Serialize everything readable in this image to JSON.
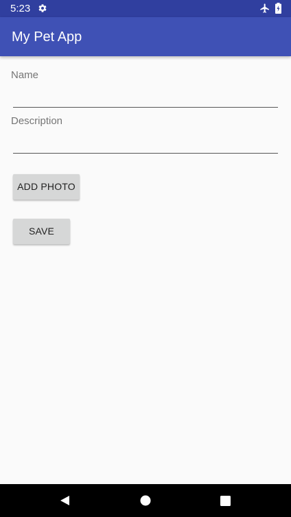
{
  "status_bar": {
    "time": "5:23",
    "icons": [
      "gear-icon",
      "airplane-icon",
      "battery-icon"
    ]
  },
  "app_bar": {
    "title": "My Pet App",
    "color": "#3f51b5",
    "status_color": "#303f9f"
  },
  "form": {
    "name_label": "Name",
    "name_value": "",
    "description_label": "Description",
    "description_value": ""
  },
  "buttons": {
    "add_photo_label": "ADD PHOTO",
    "save_label": "SAVE"
  },
  "nav_bar": {
    "icons": [
      "back-icon",
      "home-icon",
      "recents-icon"
    ]
  }
}
